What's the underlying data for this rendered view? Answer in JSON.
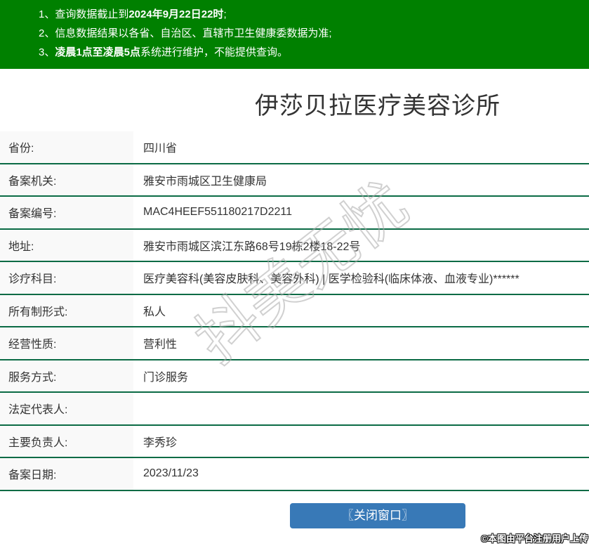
{
  "notices": {
    "items": [
      {
        "pre": "1、查询数据截止到",
        "bold": "2024年9月22日22时",
        "post": ";"
      },
      {
        "pre": "2、信息数据结果以各省、自治区、直辖市卫生健康委数据为准;",
        "bold": "",
        "post": ""
      },
      {
        "pre": "3、",
        "bold": "凌晨1点至凌晨5点",
        "post": "系统进行维护，不能提供查询。"
      }
    ]
  },
  "page": {
    "title": "伊莎贝拉医疗美容诊所"
  },
  "table": {
    "rows": [
      {
        "label": "省份:",
        "value": "四川省"
      },
      {
        "label": "备案机关:",
        "value": "雅安市雨城区卫生健康局"
      },
      {
        "label": "备案编号:",
        "value": "MAC4HEEF551180217D2211"
      },
      {
        "label": "地址:",
        "value": "雅安市雨城区滨江东路68号19栋2楼18-22号"
      },
      {
        "label": "诊疗科目:",
        "value": "医疗美容科(美容皮肤科、美容外科) | 医学检验科(临床体液、血液专业)******"
      },
      {
        "label": "所有制形式:",
        "value": "私人"
      },
      {
        "label": "经营性质:",
        "value": "营利性"
      },
      {
        "label": "服务方式:",
        "value": "门诊服务"
      },
      {
        "label": "法定代表人:",
        "value": ""
      },
      {
        "label": "主要负责人:",
        "value": "李秀珍"
      },
      {
        "label": "备案日期:",
        "value": "2023/11/23"
      }
    ]
  },
  "footer": {
    "close_button": "〖关闭窗口〗",
    "credit": "©本图由平台注册用户上传"
  },
  "watermark": {
    "text": "抖美无忧"
  },
  "colors": {
    "header_green": "#008000",
    "row_border_green": "#0b6b45",
    "button_blue": "#3879b7",
    "label_bg": "#f9f9f9"
  }
}
